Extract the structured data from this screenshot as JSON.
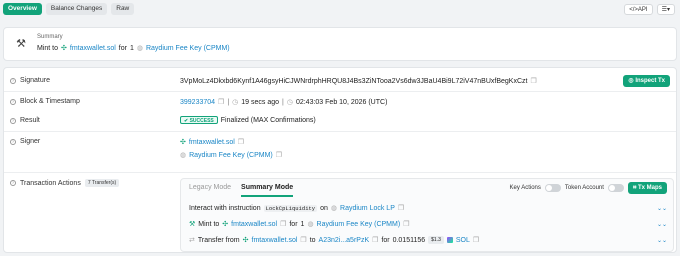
{
  "tabs": [
    "Overview",
    "Balance Changes",
    "Raw"
  ],
  "toolbar": {
    "api_label": "</>API",
    "menu_icon": "list-icon"
  },
  "summary": {
    "title": "Summary",
    "action": "Mint to",
    "recipient": "fmtaxwallet.sol",
    "for_word": "for",
    "amount": "1",
    "token": "Raydium Fee Key (CPMM)"
  },
  "signature": {
    "label": "Signature",
    "value": "3VpMoLz4Dkxbd6Kynf1A46gsyHiCJWNrdrphHRQU8J4Bs3ZiNTooa2Vs6dw3JBaU4Bi9L72iV47nBUxfBegKxCzt",
    "inspect_label": "Inspect Tx"
  },
  "block": {
    "label": "Block & Timestamp",
    "slot": "399233704",
    "ago": "19 secs ago",
    "timestamp": "02:43:03 Feb 10, 2026 (UTC)"
  },
  "result": {
    "label": "Result",
    "status": "SUCCESS",
    "detail": "Finalized (MAX Confirmations)"
  },
  "signer": {
    "label": "Signer",
    "wallet": "fmtaxwallet.sol",
    "token": "Raydium Fee Key (CPMM)"
  },
  "actions": {
    "label": "Transaction Actions",
    "count": "7 Transfer(s)",
    "legacy_mode": "Legacy Mode",
    "summary_mode": "Summary Mode",
    "key_actions": "Key Actions",
    "token_account": "Token Account",
    "tx_maps": "Tx Maps",
    "lines": {
      "interact": {
        "prefix": "Interact with instruction",
        "instruction": "LockCpLiquidity",
        "on": "on",
        "program": "Raydium Lock LP"
      },
      "mint": {
        "prefix": "Mint to",
        "wallet": "fmtaxwallet.sol",
        "for_word": "for",
        "amount": "1",
        "token": "Raydium Fee Key (CPMM)"
      },
      "transfer": {
        "prefix": "Transfer from",
        "from": "fmtaxwallet.sol",
        "to_word": "to",
        "to": "A23n2i...a5rPzK",
        "for_word": "for",
        "amount": "0.0151156",
        "usd": "$1.3",
        "token": "SOL"
      }
    }
  },
  "colors": {
    "accent": "#12a37a",
    "link": "#1a86c6"
  }
}
